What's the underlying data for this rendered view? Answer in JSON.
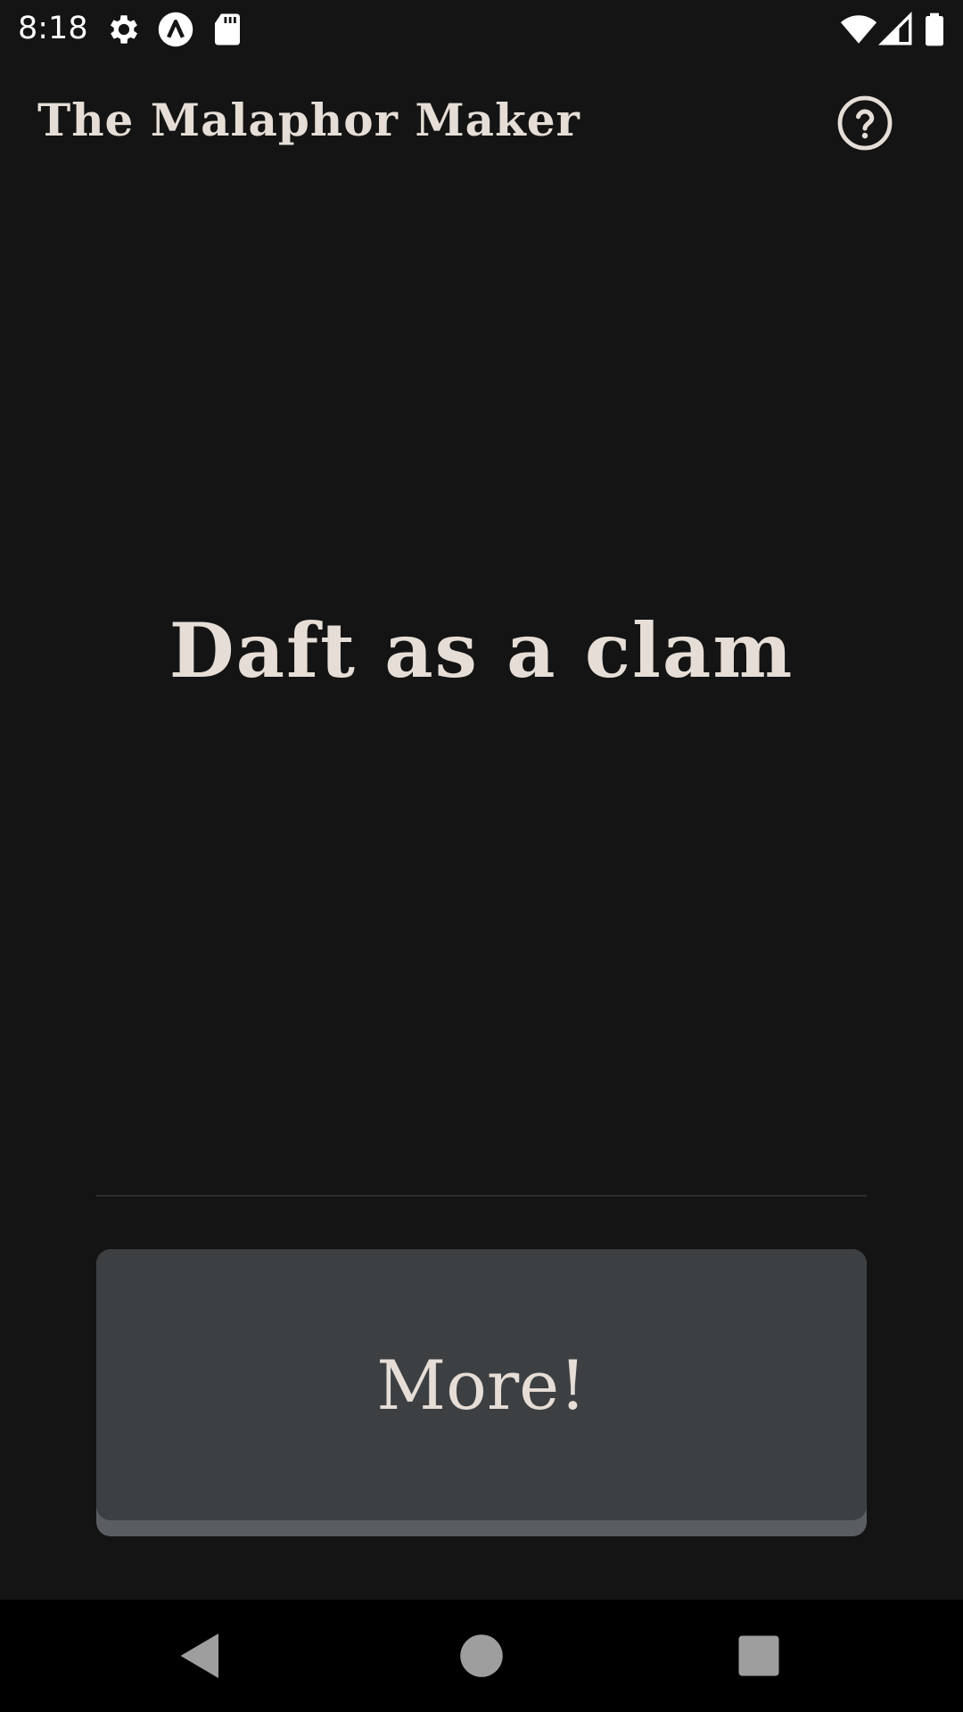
{
  "status_bar": {
    "time": "8:18",
    "left_icons": [
      "settings-gear-icon",
      "app-notification-icon",
      "sd-card-icon"
    ],
    "right_icons": [
      "wifi-icon",
      "cell-signal-icon",
      "battery-icon"
    ]
  },
  "app_bar": {
    "title": "The Malaphor Maker",
    "help_icon": "help-circle-icon"
  },
  "main": {
    "phrase": "Daft as a clam"
  },
  "actions": {
    "more_label": "More!"
  },
  "nav_bar": {
    "buttons": [
      "back-icon",
      "home-icon",
      "recents-icon"
    ]
  },
  "colors": {
    "background": "#141414",
    "text": "#e6ded6",
    "button_face": "#3d4043",
    "button_shadow": "#5a5d61",
    "nav_background": "#000000"
  }
}
